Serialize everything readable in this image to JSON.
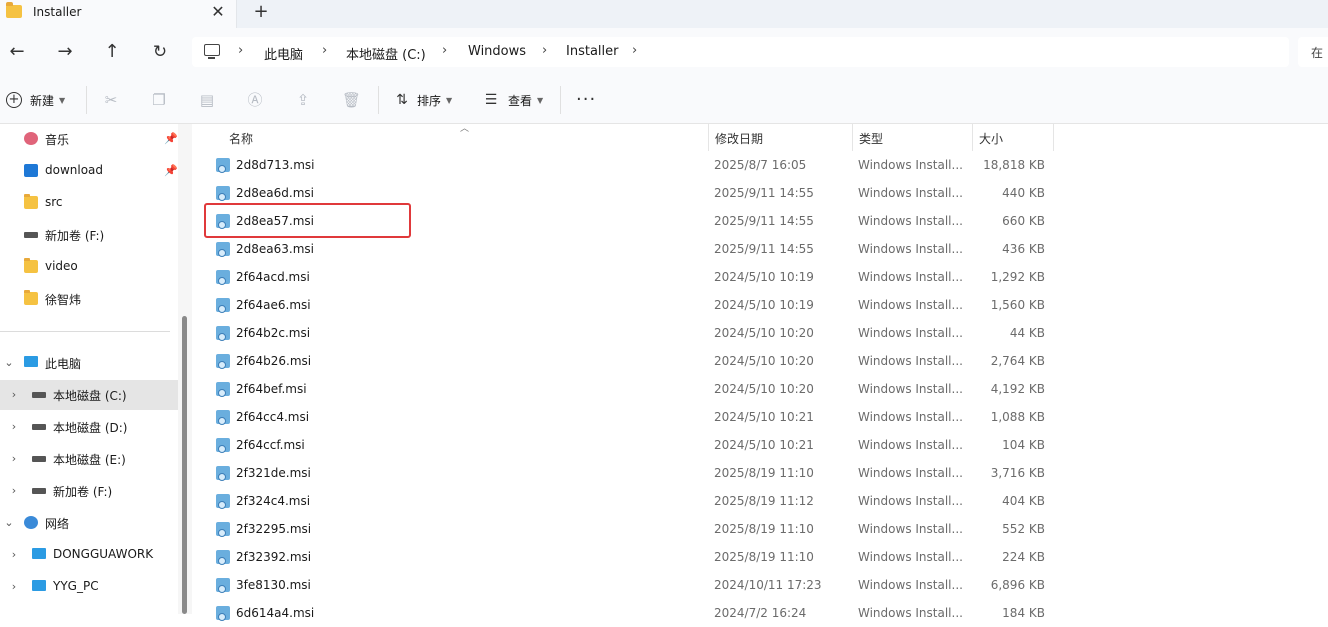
{
  "tab": {
    "title": "Installer",
    "close": "✕",
    "new": "+"
  },
  "nav": {
    "back": "←",
    "forward": "→",
    "up": "↑",
    "refresh": "↻"
  },
  "breadcrumb": [
    "此电脑",
    "本地磁盘 (C:)",
    "Windows",
    "Installer"
  ],
  "search": {
    "placeholder": "在"
  },
  "commandbar": {
    "new_label": "新建",
    "sort_label": "排序",
    "view_label": "查看",
    "more": "···"
  },
  "sidebar": {
    "quick": [
      {
        "label": "音乐",
        "icon": "music-icon",
        "pinned": true
      },
      {
        "label": "download",
        "icon": "download-icon",
        "pinned": true
      },
      {
        "label": "src",
        "icon": "folder-icon"
      },
      {
        "label": "新加卷 (F:)",
        "icon": "drive-icon"
      },
      {
        "label": "video",
        "icon": "folder-icon"
      },
      {
        "label": "徐智炜",
        "icon": "folder-icon"
      }
    ],
    "tree": [
      {
        "label": "此电脑",
        "icon": "monitor-icon",
        "expanded": true
      },
      {
        "label": "本地磁盘 (C:)",
        "icon": "drive-icon",
        "selected": true
      },
      {
        "label": "本地磁盘 (D:)",
        "icon": "drive-icon"
      },
      {
        "label": "本地磁盘 (E:)",
        "icon": "drive-icon"
      },
      {
        "label": "新加卷 (F:)",
        "icon": "drive-icon"
      },
      {
        "label": "网络",
        "icon": "globe-icon",
        "expanded": true
      },
      {
        "label": "DONGGUAWORK",
        "icon": "monitor-icon"
      },
      {
        "label": "YYG_PC",
        "icon": "monitor-icon"
      }
    ]
  },
  "columns": {
    "name": "名称",
    "date": "修改日期",
    "type": "类型",
    "size": "大小"
  },
  "files": [
    {
      "name": "2d8d713.msi",
      "date": "2025/8/7 16:05",
      "type": "Windows Install...",
      "size": "18,818 KB"
    },
    {
      "name": "2d8ea6d.msi",
      "date": "2025/9/11 14:55",
      "type": "Windows Install...",
      "size": "440 KB"
    },
    {
      "name": "2d8ea57.msi",
      "date": "2025/9/11 14:55",
      "type": "Windows Install...",
      "size": "660 KB"
    },
    {
      "name": "2d8ea63.msi",
      "date": "2025/9/11 14:55",
      "type": "Windows Install...",
      "size": "436 KB"
    },
    {
      "name": "2f64acd.msi",
      "date": "2024/5/10 10:19",
      "type": "Windows Install...",
      "size": "1,292 KB"
    },
    {
      "name": "2f64ae6.msi",
      "date": "2024/5/10 10:19",
      "type": "Windows Install...",
      "size": "1,560 KB"
    },
    {
      "name": "2f64b2c.msi",
      "date": "2024/5/10 10:20",
      "type": "Windows Install...",
      "size": "44 KB"
    },
    {
      "name": "2f64b26.msi",
      "date": "2024/5/10 10:20",
      "type": "Windows Install...",
      "size": "2,764 KB"
    },
    {
      "name": "2f64bef.msi",
      "date": "2024/5/10 10:20",
      "type": "Windows Install...",
      "size": "4,192 KB"
    },
    {
      "name": "2f64cc4.msi",
      "date": "2024/5/10 10:21",
      "type": "Windows Install...",
      "size": "1,088 KB"
    },
    {
      "name": "2f64ccf.msi",
      "date": "2024/5/10 10:21",
      "type": "Windows Install...",
      "size": "104 KB"
    },
    {
      "name": "2f321de.msi",
      "date": "2025/8/19 11:10",
      "type": "Windows Install...",
      "size": "3,716 KB"
    },
    {
      "name": "2f324c4.msi",
      "date": "2025/8/19 11:12",
      "type": "Windows Install...",
      "size": "404 KB"
    },
    {
      "name": "2f32295.msi",
      "date": "2025/8/19 11:10",
      "type": "Windows Install...",
      "size": "552 KB"
    },
    {
      "name": "2f32392.msi",
      "date": "2025/8/19 11:10",
      "type": "Windows Install...",
      "size": "224 KB"
    },
    {
      "name": "3fe8130.msi",
      "date": "2024/10/11 17:23",
      "type": "Windows Install...",
      "size": "6,896 KB"
    },
    {
      "name": "6d614a4.msi",
      "date": "2024/7/2 16:24",
      "type": "Windows Install...",
      "size": "184 KB"
    }
  ],
  "colors": {
    "highlight": "#e0393b",
    "selected_bg": "#e5e5e5",
    "accent": "#2b9be3"
  }
}
